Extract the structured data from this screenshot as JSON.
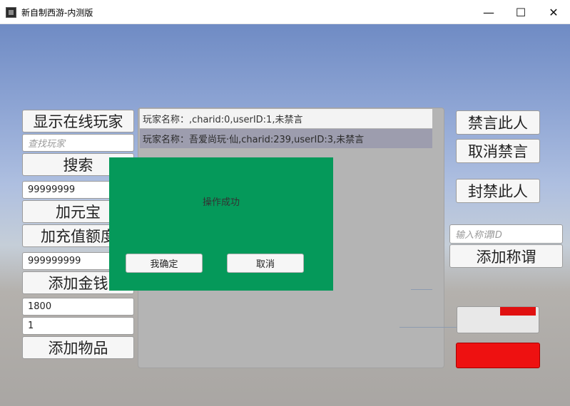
{
  "window": {
    "title": "新自制西游-内测版",
    "minimize": "—",
    "maximize": "☐",
    "close": "✕"
  },
  "left_panel": {
    "show_online_label": "显示在线玩家",
    "search_placeholder": "查找玩家",
    "search_label": "搜索",
    "yuanbao_value": "99999999",
    "add_yuanbao_label": "加元宝",
    "add_recharge_label": "加充值额度",
    "money_value": "999999999",
    "add_money_label": "添加金钱",
    "item_id_value": "1800",
    "item_count_value": "1",
    "add_item_label": "添加物品"
  },
  "player_list": [
    {
      "text": "玩家名称：,charid:0,userID:1,未禁言"
    },
    {
      "text": "玩家名称：吾爱尚玩·仙,charid:239,userID:3,未禁言"
    }
  ],
  "dialog": {
    "message": "操作成功",
    "confirm_label": "我确定",
    "cancel_label": "取消"
  },
  "right_panel": {
    "mute_label": "禁言此人",
    "unmute_label": "取消禁言",
    "ban_label": "封禁此人",
    "title_placeholder": "输入称谓ID",
    "add_title_label": "添加称谓",
    "garbled_button_label": "",
    "red_button_label": ""
  },
  "colors": {
    "dialog_bg": "#05995a",
    "red_button": "#ee1111"
  }
}
